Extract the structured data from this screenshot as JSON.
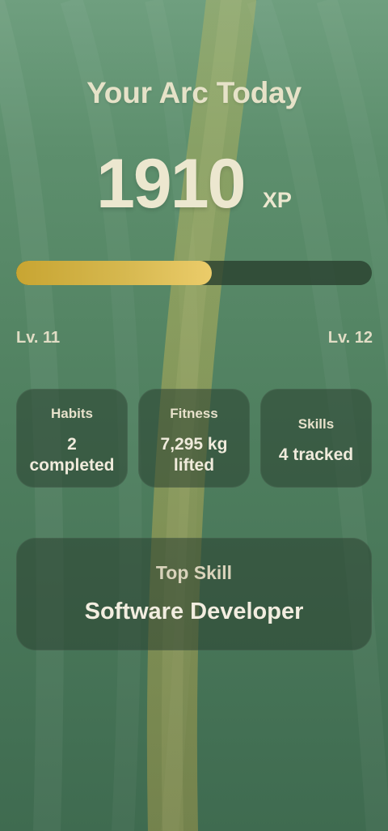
{
  "screen": {
    "title": "Your Arc Today",
    "xp": {
      "value": "1910",
      "unit": "XP",
      "progress_fraction": 0.55
    },
    "levels": {
      "current": "Lv. 11",
      "next": "Lv. 12"
    },
    "stats": [
      {
        "label": "Habits",
        "value": "2 completed"
      },
      {
        "label": "Fitness",
        "value": "7,295 kg lifted"
      },
      {
        "label": "Skills",
        "value": "4 tracked"
      }
    ],
    "top_skill": {
      "label": "Top Skill",
      "name": "Software Developer"
    },
    "colors": {
      "background_top": "#6f9f7f",
      "background_bottom": "#3f6b50",
      "accent_gold": "#e8c55d",
      "card_fill": "#2a402f",
      "text_light": "#ece7cf"
    }
  }
}
